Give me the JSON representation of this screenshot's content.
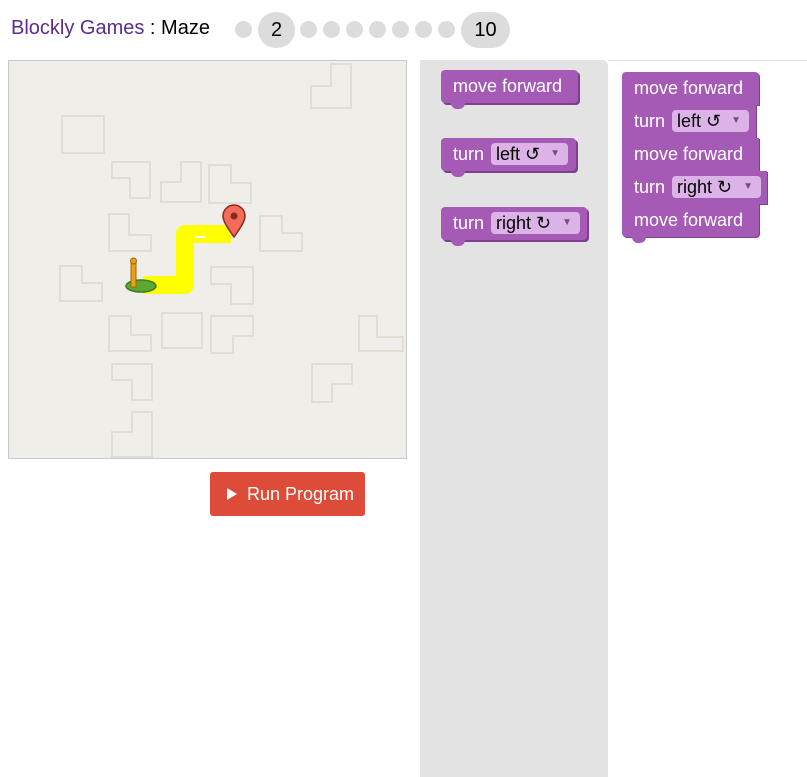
{
  "header": {
    "app_link": "Blockly Games",
    "separator": " : ",
    "game_name": "Maze",
    "current_level": "2",
    "last_level": "10"
  },
  "run_button": {
    "label": "Run Program",
    "icon": "play-icon"
  },
  "toolbox": {
    "move": "move forward",
    "turn": "turn",
    "left": "left ↺",
    "right": "right ↻"
  },
  "workspace": {
    "b1": "move forward",
    "b2_word": "turn",
    "b2_dir": "left ↺",
    "b3": "move forward",
    "b4_word": "turn",
    "b4_dir": "right ↻",
    "b5": "move forward"
  },
  "colors": {
    "block": "#a55bb5",
    "dropdown": "#dcb3e6",
    "run": "#dd4b39",
    "path": "#ffff00",
    "marker": "#f26b5b"
  }
}
